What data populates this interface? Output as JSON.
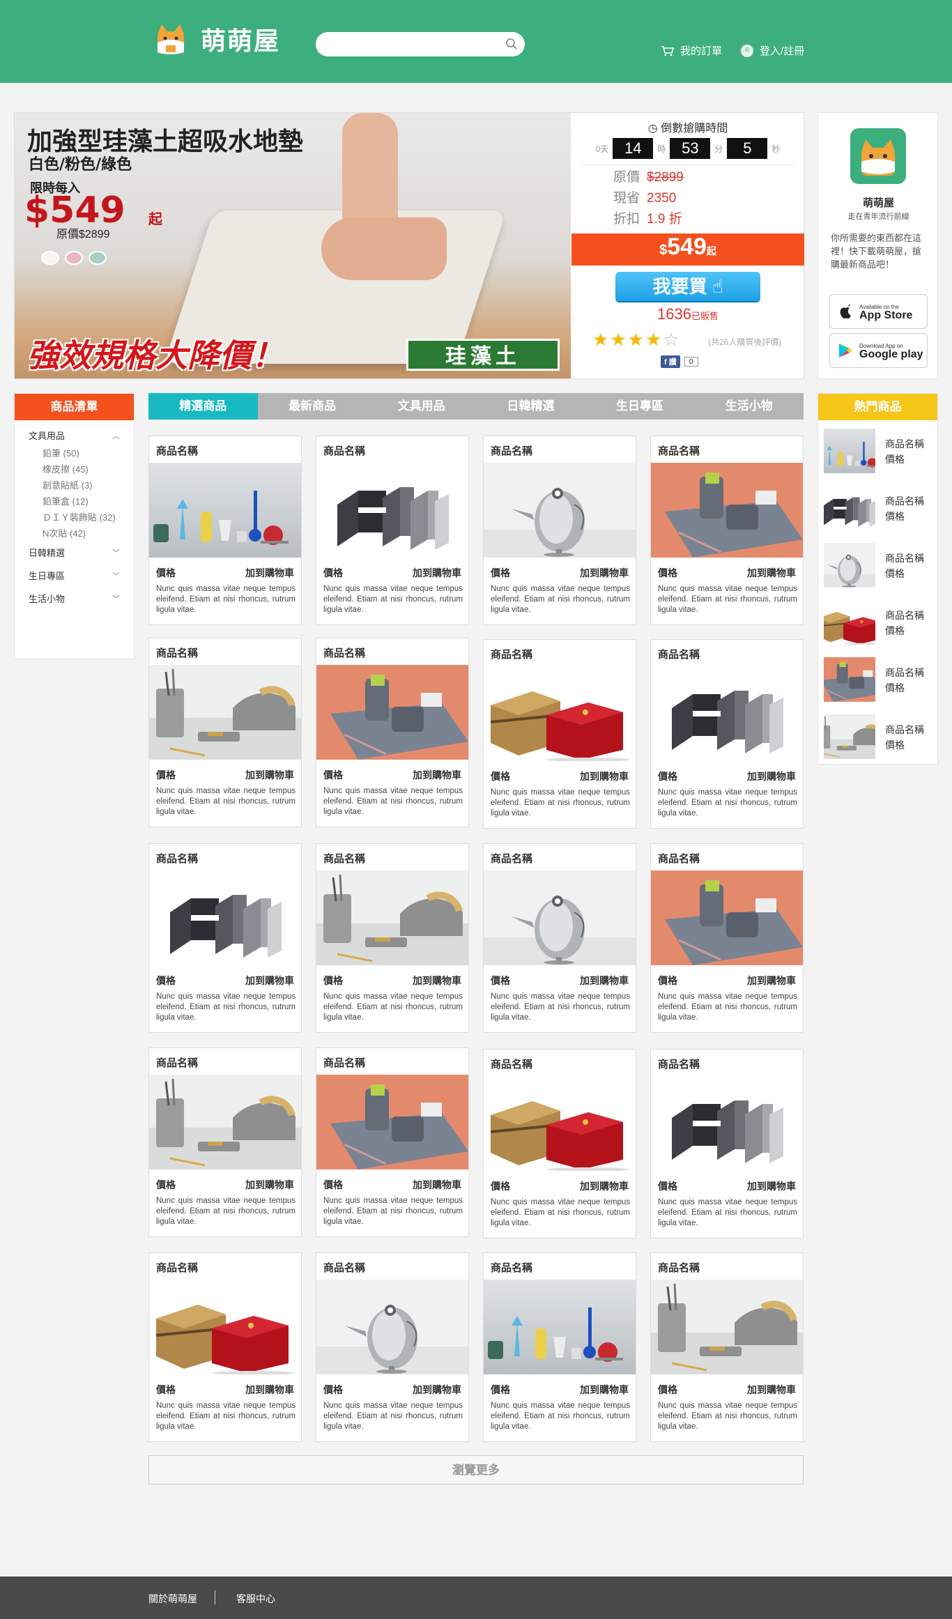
{
  "header": {
    "brand": "萌萌屋",
    "search_placeholder": "",
    "my_orders": "我的訂單",
    "login": "登入/註冊"
  },
  "banner": {
    "title": "加強型珪藻土超吸水地墊",
    "colors": "白色/粉色/綠色",
    "limit_label": "限時每入",
    "price": "$549",
    "price_suffix": "起",
    "original": "原價$2899",
    "slogan": "強效規格大降價！",
    "tag": "珪藻土"
  },
  "deal": {
    "countdown_title": "倒數搶購時間",
    "days_label": "0天",
    "hours": "14",
    "hours_label": "時",
    "minutes": "53",
    "minutes_label": "分",
    "seconds": "5",
    "seconds_label": "秒",
    "original_label": "原價",
    "original_value": "$2899",
    "save_label": "現省",
    "save_value": "2350",
    "discount_label": "折扣",
    "discount_value": "1.9 折",
    "price_currency": "$",
    "price_value": "549",
    "price_suffix": "起",
    "buy_button": "我要買",
    "sold_count": "1636",
    "sold_label": "已販售",
    "rating": 4,
    "rating_max": 5,
    "reviews": "(共26人購買後評價)",
    "like_label": "讚",
    "like_count": "0"
  },
  "app": {
    "name": "萌萌屋",
    "subtitle": "走在青年流行前線",
    "description": "你所需要的東西都在這裡！快下載萌萌屋，搶購最新商品吧！",
    "appstore_small": "Available on the",
    "appstore_main": "App Store",
    "google_small": "Download App on",
    "google_main": "Google play"
  },
  "sidebar": {
    "title": "商品清單",
    "color": "#f4511e",
    "categories": [
      {
        "label": "文具用品",
        "open": true,
        "children": [
          {
            "label": "鉛筆",
            "count": "(50)"
          },
          {
            "label": "橡皮擦",
            "count": "(45)"
          },
          {
            "label": "創意貼紙",
            "count": "(3)"
          },
          {
            "label": "鉛筆盒",
            "count": "(12)"
          },
          {
            "label": "ＤＩＹ裝飾貼",
            "count": "(32)"
          },
          {
            "label": "N次貼",
            "count": "(42)"
          }
        ]
      },
      {
        "label": "日韓精選",
        "open": false
      },
      {
        "label": "生日專區",
        "open": false
      },
      {
        "label": "生活小物",
        "open": false
      }
    ]
  },
  "tabs": [
    "精選商品",
    "最新商品",
    "文具用品",
    "日韓精選",
    "生日專區",
    "生活小物"
  ],
  "product": {
    "name": "商品名稱",
    "price": "價格",
    "cart": "加到購物車",
    "desc": "Nunc quis massa vitae neque tempus eleifend. Etiam at nisi rhoncus, rutrum ligula vitae."
  },
  "product_images": [
    "figures",
    "letters",
    "bird",
    "desk",
    "tape",
    "desk",
    "boxes",
    "letters",
    "letters",
    "tape",
    "bird",
    "desk",
    "tape",
    "desk",
    "boxes",
    "letters",
    "boxes",
    "bird",
    "figures",
    "tape"
  ],
  "more_button": "瀏覽更多",
  "hot": {
    "title": "熱門商品",
    "color": "#f5c518",
    "name": "商品名稱",
    "price": "價格",
    "images": [
      "figures",
      "letters",
      "bird",
      "boxes",
      "desk",
      "tape"
    ]
  },
  "footer": {
    "about": "關於萌萌屋",
    "service": "客服中心"
  },
  "colors": {
    "brand_green": "#3daf7f",
    "tab_active": "#19b9c2",
    "deal_orange": "#f4511e"
  }
}
